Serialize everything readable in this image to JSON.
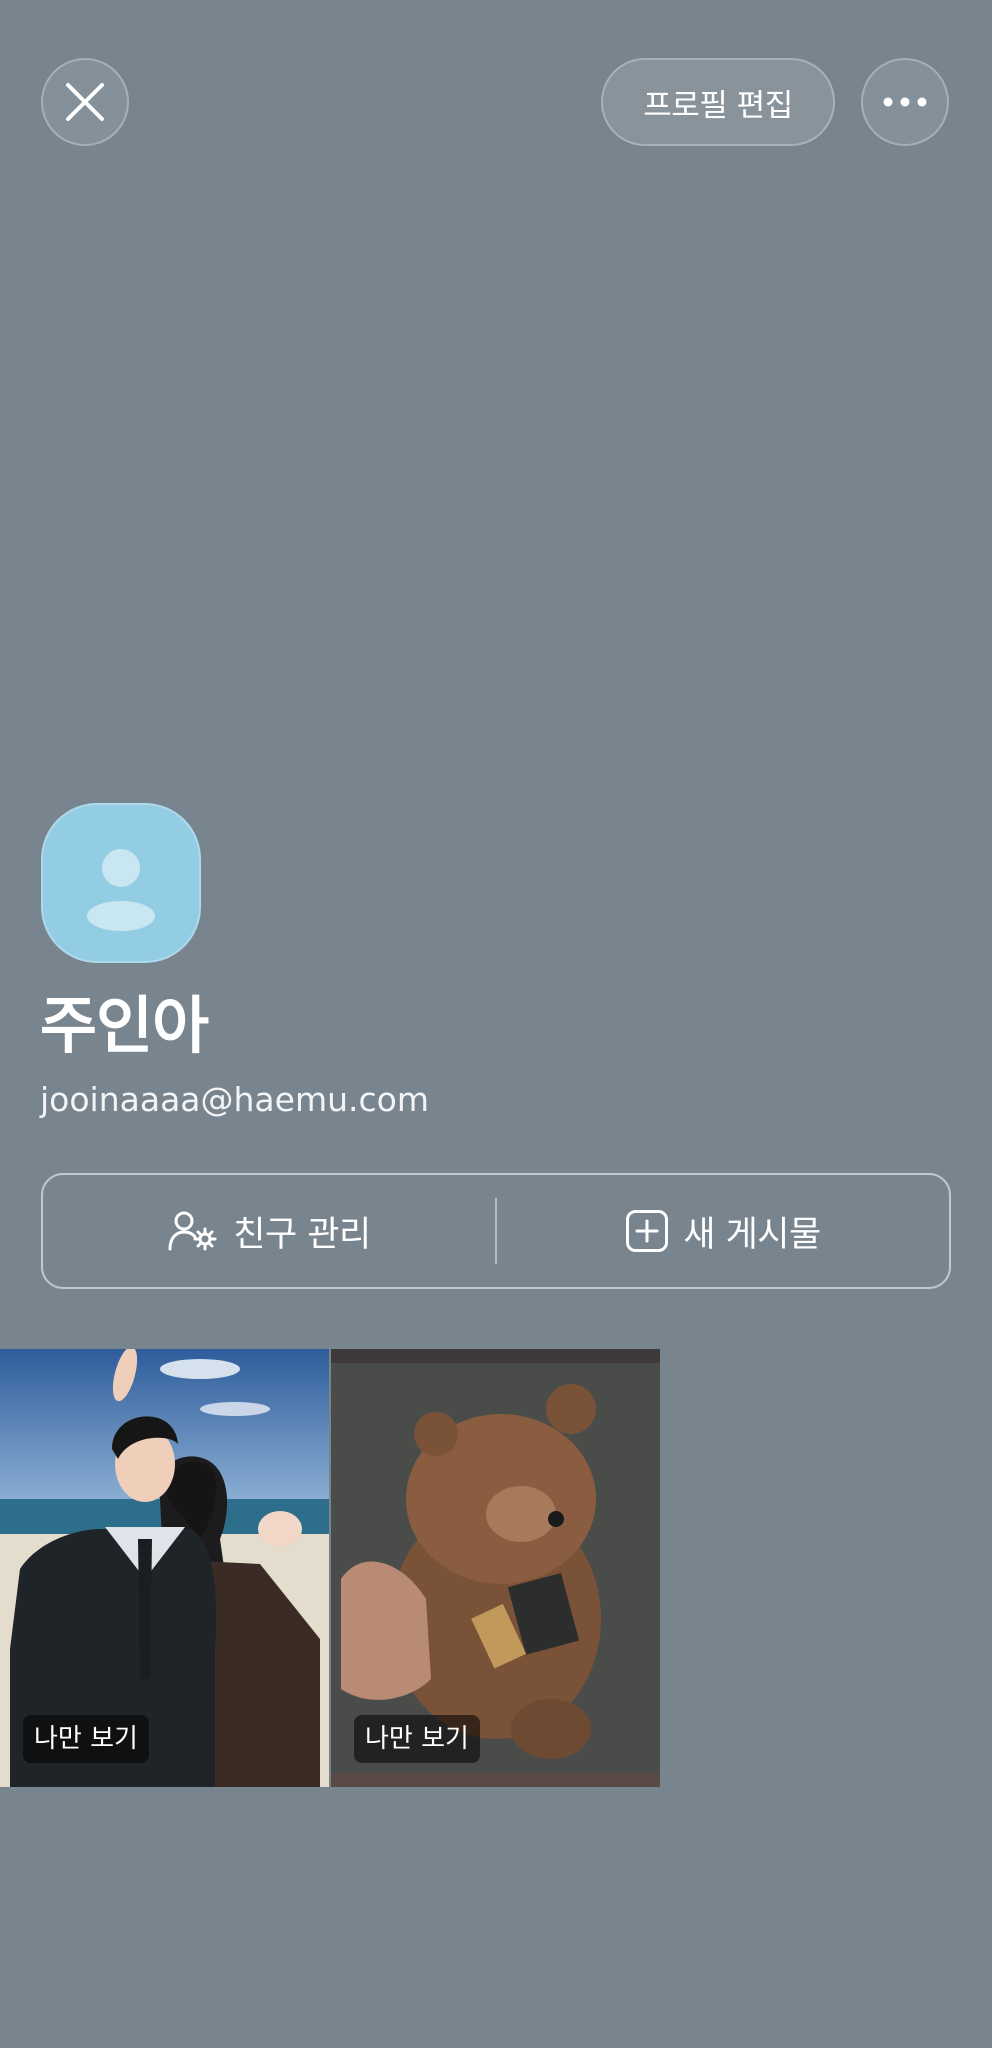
{
  "header": {
    "close_icon": "close-icon",
    "edit_profile_label": "프로필 편집",
    "more_icon": "more-horizontal-icon"
  },
  "profile": {
    "avatar_icon": "default-person-avatar",
    "name": "주인아",
    "email": "jooinaaaa@haemu.com"
  },
  "actions": {
    "manage_friends_label": "친구 관리",
    "manage_friends_icon": "person-settings-icon",
    "new_post_label": "새 게시물",
    "new_post_icon": "plus-square-icon"
  },
  "posts": [
    {
      "badge": "나만 보기",
      "image": "couple-photo-at-beach"
    },
    {
      "badge": "나만 보기",
      "image": "brown-teddy-bear"
    }
  ],
  "colors": {
    "background": "#78858f",
    "avatar": "#93cde3"
  }
}
